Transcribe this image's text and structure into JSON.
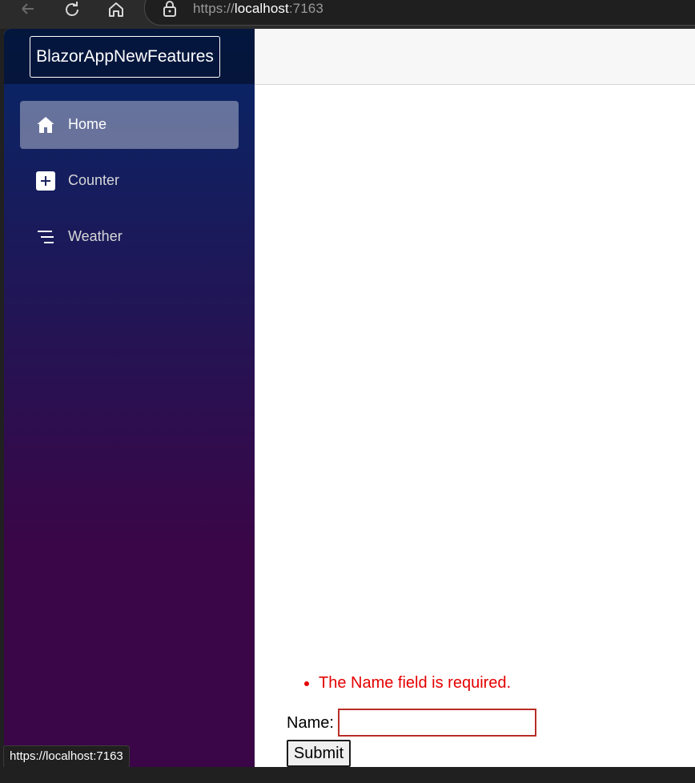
{
  "browser": {
    "url_scheme": "https://",
    "url_host": "localhost",
    "url_port": ":7163",
    "icons": [
      "back-arrow-icon",
      "refresh-icon",
      "home-icon",
      "lock-icon"
    ]
  },
  "app": {
    "brand": "BlazorAppNewFeatures",
    "nav": [
      {
        "label": "Home",
        "icon": "house-icon",
        "active": true
      },
      {
        "label": "Counter",
        "icon": "plus-square-icon",
        "active": false
      },
      {
        "label": "Weather",
        "icon": "list-icon",
        "active": false
      }
    ]
  },
  "form": {
    "validation_errors": [
      "The Name field is required."
    ],
    "name_label": "Name:",
    "name_value": "",
    "submit_label": "Submit"
  },
  "status_bar": {
    "hover_url": "https://localhost:7163"
  },
  "colors": {
    "sidebar_top": "#052767",
    "sidebar_bottom": "#3a0647",
    "error": "#e50000",
    "top_row": "#f7f7f7"
  }
}
